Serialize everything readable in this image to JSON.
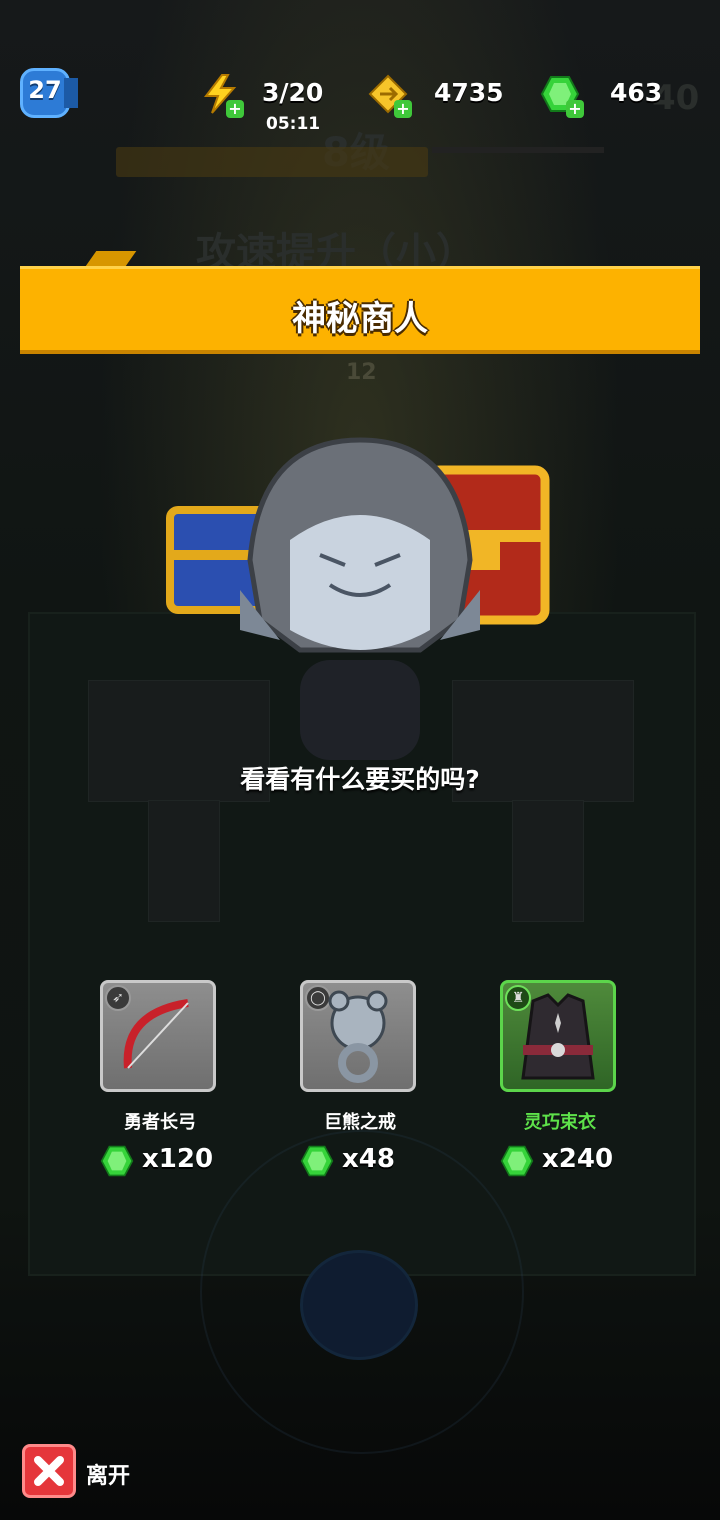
{
  "hud": {
    "level": "27",
    "energy": "3/20",
    "energy_timer": "05:11",
    "coins": "4735",
    "gems": "463"
  },
  "background": {
    "ghost_level": "8级",
    "ghost_skill": "攻速提升（小）",
    "ghost_counter": "40",
    "ghost_small_number": "12"
  },
  "banner": {
    "title": "神秘商人"
  },
  "dialog": {
    "text": "看看有什么要买的吗?"
  },
  "items": [
    {
      "name": "勇者长弓",
      "price": "x120",
      "slot_icon": "bow-slot-icon",
      "icon": "bow-icon",
      "rarity": "common"
    },
    {
      "name": "巨熊之戒",
      "price": "x48",
      "slot_icon": "ring-slot-icon",
      "icon": "bear-ring-icon",
      "rarity": "common"
    },
    {
      "name": "灵巧束衣",
      "price": "x240",
      "slot_icon": "armor-slot-icon",
      "icon": "vest-icon",
      "rarity": "uncommon"
    }
  ],
  "leave": {
    "label": "离开"
  },
  "colors": {
    "banner": "#fdb200",
    "gem": "#3fdc3a",
    "uncommon": "#5ee24a",
    "close": "#e5363b"
  }
}
